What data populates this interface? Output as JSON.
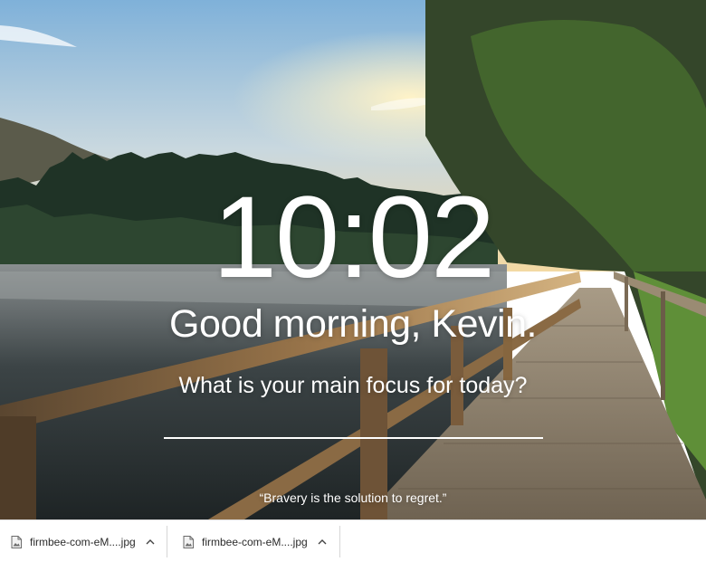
{
  "dashboard": {
    "time": "10:02",
    "greeting": "Good morning, Kevin.",
    "focus_question": "What is your main focus for today?",
    "focus_input_value": "",
    "quote": "“Bravery is the solution to regret.”"
  },
  "download_bar": {
    "items": [
      {
        "filename": "firmbee-com-eM....jpg",
        "icon": "image-file-icon",
        "menu_icon": "chevron-up-icon"
      },
      {
        "filename": "firmbee-com-eM....jpg",
        "icon": "image-file-icon",
        "menu_icon": "chevron-up-icon"
      }
    ]
  },
  "colors": {
    "text": "#ffffff",
    "download_bar_bg": "#ffffff",
    "download_text": "#2b2b2b"
  }
}
